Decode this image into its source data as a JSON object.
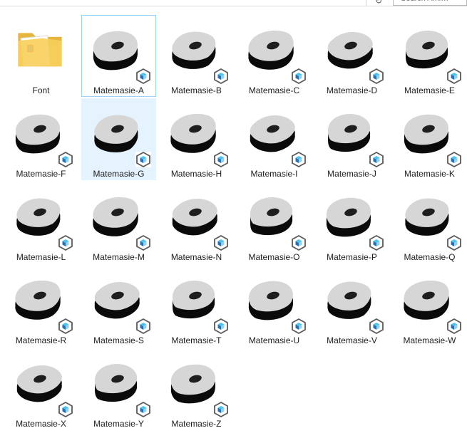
{
  "toolbar": {
    "refresh_glyph": "↻",
    "search_placeholder": "Search Ami…"
  },
  "colors": {
    "selection": "#e5f3ff",
    "hover_border": "#99d1ff",
    "glyph_face": "#d6d6d6",
    "glyph_side": "#0a0a0a",
    "folder": "#f7cf5b"
  },
  "items": [
    {
      "label": "Font",
      "type": "folder",
      "icon": "folder-icon"
    },
    {
      "label": "Matemasie-A",
      "type": "font",
      "icon": "font-file-icon",
      "state": "hover"
    },
    {
      "label": "Matemasie-B",
      "type": "font",
      "icon": "font-file-icon"
    },
    {
      "label": "Matemasie-C",
      "type": "font",
      "icon": "font-file-icon"
    },
    {
      "label": "Matemasie-D",
      "type": "font",
      "icon": "font-file-icon"
    },
    {
      "label": "Matemasie-E",
      "type": "font",
      "icon": "font-file-icon"
    },
    {
      "label": "Matemasie-F",
      "type": "font",
      "icon": "font-file-icon"
    },
    {
      "label": "Matemasie-G",
      "type": "font",
      "icon": "font-file-icon",
      "state": "selected"
    },
    {
      "label": "Matemasie-H",
      "type": "font",
      "icon": "font-file-icon"
    },
    {
      "label": "Matemasie-I",
      "type": "font",
      "icon": "font-file-icon"
    },
    {
      "label": "Matemasie-J",
      "type": "font",
      "icon": "font-file-icon"
    },
    {
      "label": "Matemasie-K",
      "type": "font",
      "icon": "font-file-icon"
    },
    {
      "label": "Matemasie-L",
      "type": "font",
      "icon": "font-file-icon"
    },
    {
      "label": "Matemasie-M",
      "type": "font",
      "icon": "font-file-icon"
    },
    {
      "label": "Matemasie-N",
      "type": "font",
      "icon": "font-file-icon"
    },
    {
      "label": "Matemasie-O",
      "type": "font",
      "icon": "font-file-icon"
    },
    {
      "label": "Matemasie-P",
      "type": "font",
      "icon": "font-file-icon"
    },
    {
      "label": "Matemasie-Q",
      "type": "font",
      "icon": "font-file-icon"
    },
    {
      "label": "Matemasie-R",
      "type": "font",
      "icon": "font-file-icon"
    },
    {
      "label": "Matemasie-S",
      "type": "font",
      "icon": "font-file-icon"
    },
    {
      "label": "Matemasie-T",
      "type": "font",
      "icon": "font-file-icon"
    },
    {
      "label": "Matemasie-U",
      "type": "font",
      "icon": "font-file-icon"
    },
    {
      "label": "Matemasie-V",
      "type": "font",
      "icon": "font-file-icon"
    },
    {
      "label": "Matemasie-W",
      "type": "font",
      "icon": "font-file-icon"
    },
    {
      "label": "Matemasie-X",
      "type": "font",
      "icon": "font-file-icon"
    },
    {
      "label": "Matemasie-Y",
      "type": "font",
      "icon": "font-file-icon"
    },
    {
      "label": "Matemasie-Z",
      "type": "font",
      "icon": "font-file-icon"
    }
  ]
}
